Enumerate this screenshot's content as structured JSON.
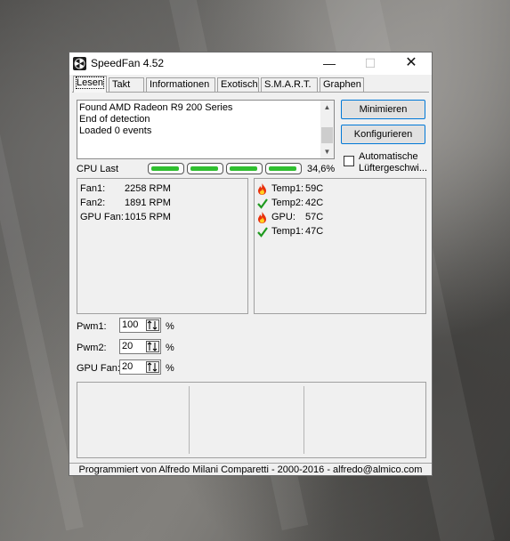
{
  "window": {
    "title": "SpeedFan 4.52"
  },
  "titlebar_buttons": {
    "minimize": "—",
    "maximize": "☐",
    "close": "✕"
  },
  "tabs": [
    {
      "label": "Lesen"
    },
    {
      "label": "Takt"
    },
    {
      "label": "Informationen"
    },
    {
      "label": "Exotisch"
    },
    {
      "label": "S.M.A.R.T."
    },
    {
      "label": "Graphen"
    }
  ],
  "log": [
    "Found AMD Radeon R9 200 Series",
    "End of detection",
    "Loaded 0 events"
  ],
  "buttons": {
    "minimize": "Minimieren",
    "configure": "Konfigurieren"
  },
  "auto_fan": {
    "label_line1": "Automatische",
    "label_line2": "Lüftergeschwi...",
    "checked": false
  },
  "cpu": {
    "label": "CPU Last",
    "percent": "34,6%",
    "bars": 4
  },
  "fans": [
    {
      "name": "Fan1:",
      "value": "2258 RPM"
    },
    {
      "name": "Fan2:",
      "value": "1891 RPM"
    },
    {
      "name": "GPU Fan:",
      "value": "1015 RPM"
    }
  ],
  "temps": [
    {
      "status": "hot",
      "icon": "flame-icon",
      "name": "Temp1:",
      "value": "59C"
    },
    {
      "status": "ok",
      "icon": "check-icon",
      "name": "Temp2:",
      "value": "42C"
    },
    {
      "status": "hot",
      "icon": "flame-icon",
      "name": "GPU:",
      "value": "57C"
    },
    {
      "status": "ok",
      "icon": "check-icon",
      "name": "Temp1:",
      "value": "47C"
    }
  ],
  "pwm": [
    {
      "label": "Pwm1:",
      "value": "100",
      "unit": "%"
    },
    {
      "label": "Pwm2:",
      "value": "20",
      "unit": "%"
    },
    {
      "label": "GPU Fan:",
      "value": "20",
      "unit": "%"
    }
  ],
  "status_text": "Programmiert von Alfredo Milani Comparetti - 2000-2016 - alfredo@almico.com",
  "colors": {
    "accent": "#0078d7",
    "cpu_bar": "#2fbf2f",
    "flame": "#e8300c",
    "check": "#1f9a1f"
  }
}
